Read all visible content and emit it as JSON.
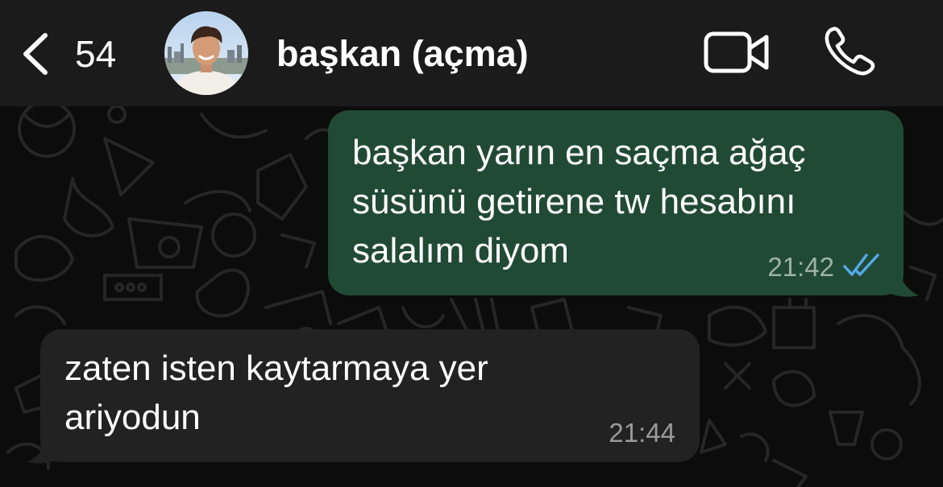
{
  "header": {
    "back_count": "54",
    "contact_name": "başkan (açma)",
    "avatar_icon": "contact-photo",
    "video_icon": "video-camera-icon",
    "call_icon": "phone-icon",
    "background": "#1b1b1b"
  },
  "messages": [
    {
      "direction": "outgoing",
      "lines": [
        "başkan yarın en saçma ağaç",
        "süsünü getirene tw hesabını",
        "salalım diyom"
      ],
      "time": "21:42",
      "status": "read",
      "bubble_color": "#214a35",
      "tick_color": "#53a9e8"
    },
    {
      "direction": "incoming",
      "lines": [
        "zaten isten kaytarmaya yer",
        "ariyodun"
      ],
      "time": "21:44",
      "bubble_color": "#222222"
    }
  ]
}
